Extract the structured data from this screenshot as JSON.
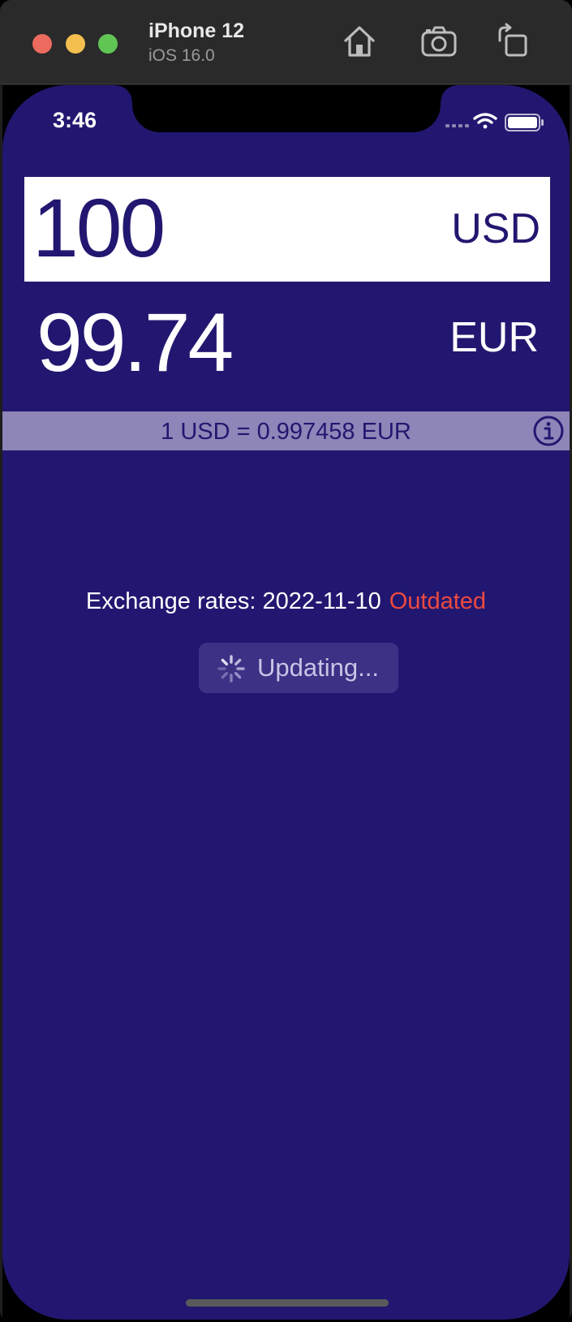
{
  "simulator": {
    "device_name": "iPhone 12",
    "os_version": "iOS 16.0",
    "icons": [
      "home-icon",
      "screenshot-camera-icon",
      "rotate-icon"
    ]
  },
  "status_bar": {
    "time": "3:46",
    "icons": [
      "signal-icon",
      "wifi-icon",
      "battery-icon"
    ]
  },
  "converter": {
    "input_amount": "100",
    "input_currency": "USD",
    "output_amount": "99.74",
    "output_currency": "EUR",
    "rate_text": "1 USD = 0.997458 EUR",
    "info_icon": "info-icon"
  },
  "rates": {
    "label": "Exchange rates: 2022-11-10",
    "status": "Outdated",
    "update_button_label": "Updating..."
  },
  "colors": {
    "background": "#221770",
    "rate_bar": "#8e85b8",
    "outdated": "#ec4a3f"
  }
}
